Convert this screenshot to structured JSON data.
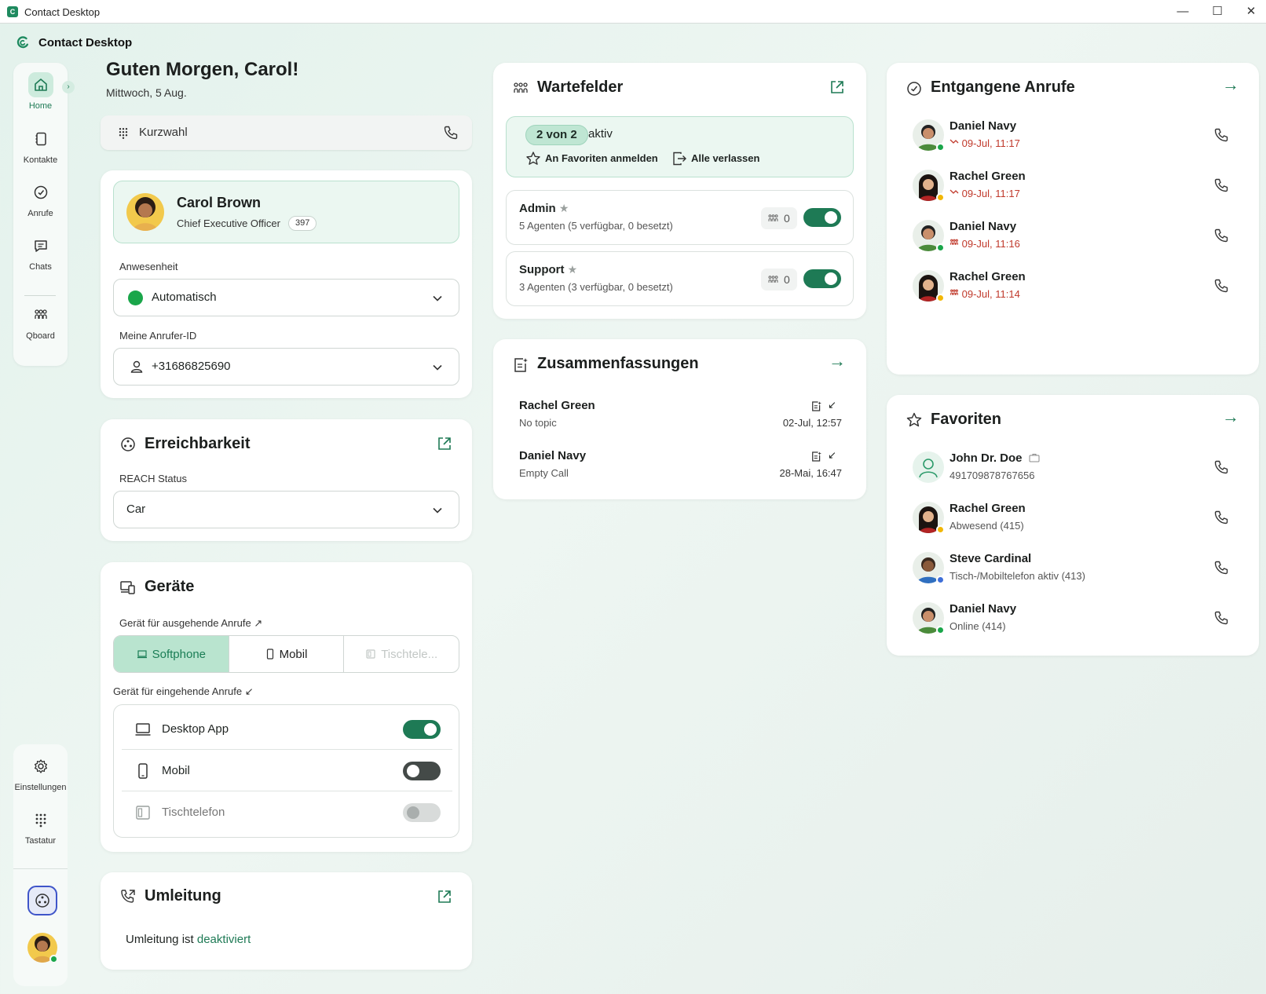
{
  "window": {
    "title": "Contact Desktop",
    "minimize": "—",
    "maximize": "☐",
    "close": "✕"
  },
  "app": {
    "name": "Contact Desktop",
    "accent": "#1e7a55"
  },
  "nav": {
    "items": [
      {
        "label": "Home",
        "icon": "home-icon"
      },
      {
        "label": "Kontakte",
        "icon": "contacts-icon"
      },
      {
        "label": "Anrufe",
        "icon": "calls-icon"
      },
      {
        "label": "Chats",
        "icon": "chat-icon"
      },
      {
        "label": "Qboard",
        "icon": "qboard-icon"
      }
    ],
    "bottom": [
      {
        "label": "Einstellungen",
        "icon": "gear-icon"
      },
      {
        "label": "Tastatur",
        "icon": "keypad-icon"
      }
    ],
    "expand": "›"
  },
  "header": {
    "greeting": "Guten Morgen, Carol!",
    "date": "Mittwoch, 5 Aug."
  },
  "quickdial": {
    "placeholder": "Kurzwahl"
  },
  "profile": {
    "name": "Carol Brown",
    "title": "Chief Executive Officer",
    "extension": "397",
    "presence_label": "Anwesenheit",
    "presence_value": "Automatisch",
    "callerid_label": "Meine Anrufer-ID",
    "callerid_value": "+31686825690"
  },
  "reach": {
    "title": "Erreichbarkeit",
    "status_label": "REACH Status",
    "status_value": "Car"
  },
  "devices": {
    "title": "Geräte",
    "outgoing_label": "Gerät für ausgehende Anrufe",
    "outgoing_arrow": "↗",
    "outgoing_options": [
      "Softphone",
      "Mobil",
      "Tischtele..."
    ],
    "incoming_label": "Gerät für eingehende Anrufe",
    "incoming_arrow": "↙",
    "incoming": [
      {
        "label": "Desktop App",
        "state": "on"
      },
      {
        "label": "Mobil",
        "state": "off"
      },
      {
        "label": "Tischtelefon",
        "state": "disabled"
      }
    ]
  },
  "forwarding": {
    "title": "Umleitung",
    "text": "Umleitung ist",
    "status": "deaktiviert"
  },
  "queues": {
    "title": "Wartefelder",
    "active_pill": "2 von 2",
    "active_text": "aktiv",
    "login_favorites": "An Favoriten anmelden",
    "leave_all": "Alle verlassen",
    "items": [
      {
        "name": "Admin",
        "star": "★",
        "agents": "5 Agenten (5 verfügbar, 0 besetzt)",
        "waiting": "0",
        "on": true
      },
      {
        "name": "Support",
        "star": "★",
        "agents": "3 Agenten (3 verfügbar, 0 besetzt)",
        "waiting": "0",
        "on": true
      }
    ]
  },
  "summaries": {
    "title": "Zusammenfassungen",
    "items": [
      {
        "name": "Rachel Green",
        "topic": "No topic",
        "time": "02-Jul, 12:57",
        "direction": "↙"
      },
      {
        "name": "Daniel Navy",
        "topic": "Empty Call",
        "time": "28-Mai, 16:47",
        "direction": "↙"
      }
    ]
  },
  "missed": {
    "title": "Entgangene Anrufe",
    "items": [
      {
        "name": "Daniel Navy",
        "time": "09-Jul, 11:17",
        "status_color": "#1aa64a",
        "kind": "missed-call-icon"
      },
      {
        "name": "Rachel Green",
        "time": "09-Jul, 11:17",
        "status_color": "#f2b705",
        "kind": "missed-call-icon"
      },
      {
        "name": "Daniel Navy",
        "time": "09-Jul, 11:16",
        "status_color": "#1aa64a",
        "kind": "queue-missed-icon"
      },
      {
        "name": "Rachel Green",
        "time": "09-Jul, 11:14",
        "status_color": "#f2b705",
        "kind": "queue-missed-icon"
      }
    ]
  },
  "favorites": {
    "title": "Favoriten",
    "items": [
      {
        "name": "John Dr. Doe",
        "sub": "491709878767656",
        "status_color": "",
        "kind": "placeholder"
      },
      {
        "name": "Rachel Green",
        "sub": "Abwesend (415)",
        "status_color": "#f2b705"
      },
      {
        "name": "Steve Cardinal",
        "sub": "Tisch-/Mobiltelefon aktiv (413)",
        "status_color": "#3f6fd8"
      },
      {
        "name": "Daniel Navy",
        "sub": "Online (414)",
        "status_color": "#1aa64a"
      }
    ]
  }
}
